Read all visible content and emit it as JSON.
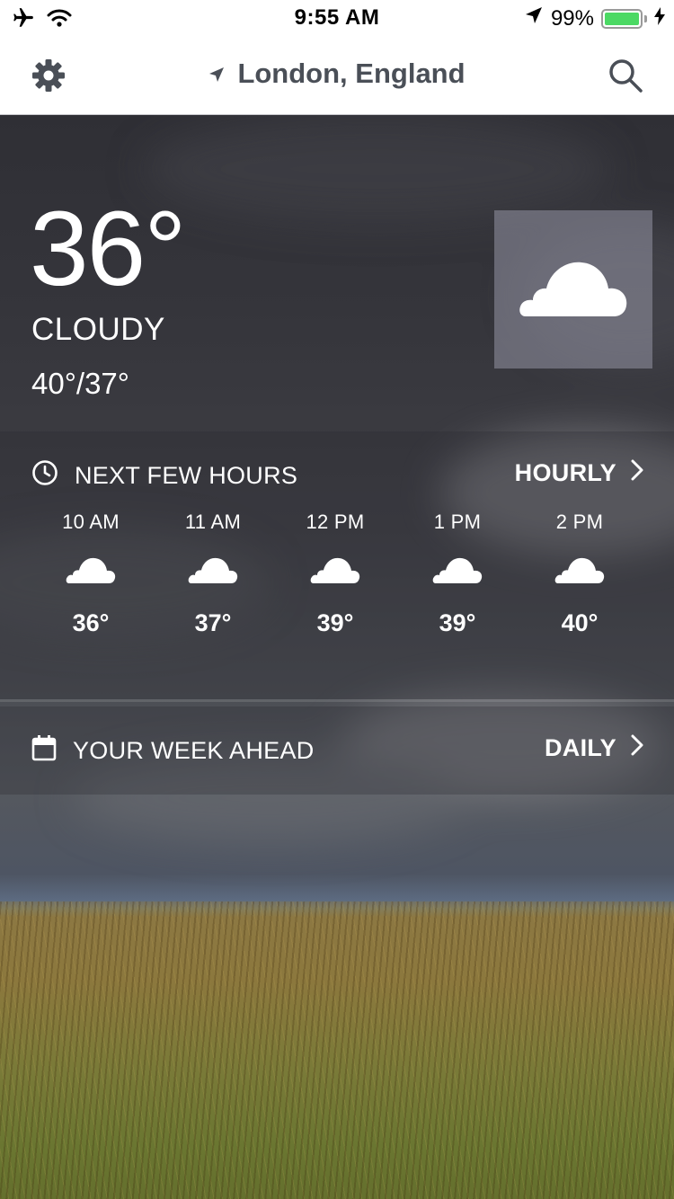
{
  "status_bar": {
    "time": "9:55 AM",
    "battery": "99%",
    "battery_level": 0.99,
    "icons": [
      "airplane-icon",
      "wifi-icon",
      "location-arrow-icon",
      "battery-icon",
      "charging-icon"
    ]
  },
  "nav": {
    "location": "London, England",
    "left_icon": "gear-icon",
    "right_icon": "search-icon",
    "location_icon": "location-arrow-icon"
  },
  "current": {
    "temp": "36°",
    "condition": "CLOUDY",
    "hi_lo": "40°/37°",
    "icon": "cloud-icon"
  },
  "hourly_section": {
    "title": "NEXT FEW HOURS",
    "link": "HOURLY",
    "icon": "clock-icon",
    "hours": [
      {
        "time": "10 AM",
        "temp": "36°",
        "icon": "cloud-icon"
      },
      {
        "time": "11 AM",
        "temp": "37°",
        "icon": "cloud-icon"
      },
      {
        "time": "12 PM",
        "temp": "39°",
        "icon": "cloud-icon"
      },
      {
        "time": "1 PM",
        "temp": "39°",
        "icon": "cloud-icon"
      },
      {
        "time": "2 PM",
        "temp": "40°",
        "icon": "cloud-icon"
      }
    ]
  },
  "weekly_section": {
    "title": "YOUR WEEK AHEAD",
    "link": "DAILY",
    "icon": "calendar-icon"
  },
  "colors": {
    "battery_fill": "#4cd964",
    "nav_text": "#4a4f57"
  }
}
